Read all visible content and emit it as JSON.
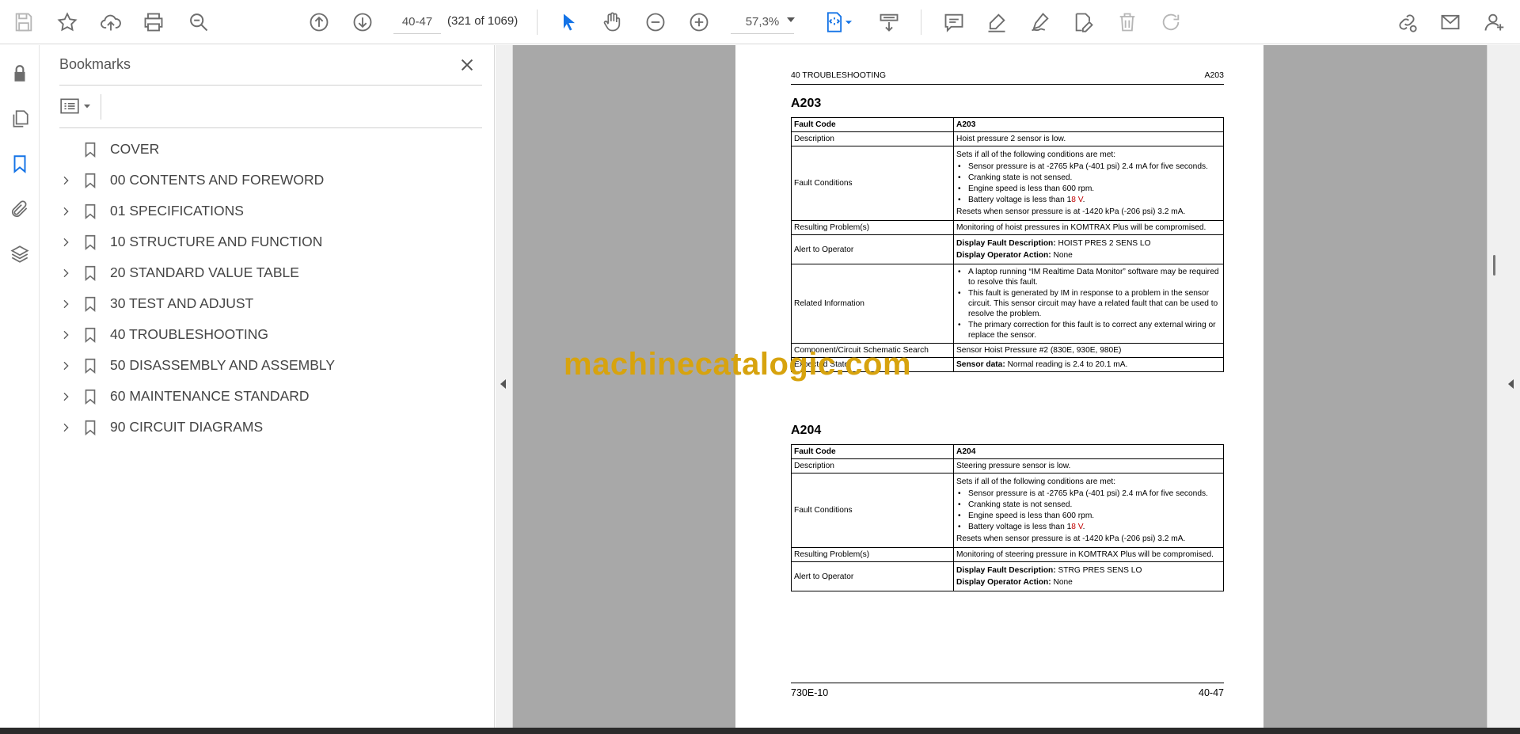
{
  "toolbar": {
    "page_value": "40-47",
    "page_count": "(321 of 1069)",
    "zoom_value": "57,3%"
  },
  "bookmarks": {
    "title": "Bookmarks",
    "items": [
      {
        "label": "COVER",
        "expandable": false
      },
      {
        "label": "00 CONTENTS AND FOREWORD",
        "expandable": true
      },
      {
        "label": "01 SPECIFICATIONS",
        "expandable": true
      },
      {
        "label": "10 STRUCTURE AND FUNCTION",
        "expandable": true
      },
      {
        "label": "20 STANDARD VALUE TABLE",
        "expandable": true
      },
      {
        "label": "30 TEST AND ADJUST",
        "expandable": true
      },
      {
        "label": "40 TROUBLESHOOTING",
        "expandable": true
      },
      {
        "label": "50 DISASSEMBLY AND ASSEMBLY",
        "expandable": true
      },
      {
        "label": "60 MAINTENANCE STANDARD",
        "expandable": true
      },
      {
        "label": "90 CIRCUIT DIAGRAMS",
        "expandable": true
      }
    ]
  },
  "document": {
    "header_left": "40 TROUBLESHOOTING",
    "header_right": "A203",
    "footer_left": "730E-10",
    "footer_right": "40-47",
    "sections": [
      {
        "title": "A203",
        "fault_code_label": "Fault Code",
        "fault_code": "A203",
        "description_label": "Description",
        "description": "Hoist pressure 2 sensor is low.",
        "fault_conditions_label": "Fault Conditions",
        "conditions_intro": "Sets if all of the following conditions are met:",
        "cond1": "Sensor pressure is at -2765 kPa (-401 psi) 2.4 mA for five seconds.",
        "cond2": "Cranking state is not sensed.",
        "cond3": "Engine speed is less than 600 rpm.",
        "cond4_pre": "Battery voltage is less than 1",
        "cond4_red": "8 V",
        "cond4_post": ".",
        "resets": "Resets when sensor pressure is at -1420 kPa (-206 psi) 3.2 mA.",
        "resulting_label": "Resulting Problem(s)",
        "resulting": "Monitoring of hoist pressures in KOMTRAX Plus will be compromised.",
        "alert_label": "Alert to Operator",
        "display_desc_label": "Display Fault Description:",
        "display_desc": "HOIST PRES 2 SENS LO",
        "display_action_label": "Display Operator Action:",
        "display_action": "None",
        "related_label": "Related Information",
        "related1": "A laptop running “IM Realtime Data Monitor” software may be required to resolve this fault.",
        "related2": "This fault is generated by IM in response to a problem in the sensor circuit. This sensor circuit may have a related fault that can be used to resolve the problem.",
        "related3": "The primary correction for this fault is to correct any external wiring or replace the sensor.",
        "component_label": "Component/Circuit Schematic Search",
        "component": "Sensor Hoist Pressure #2 (830E, 930E, 980E)",
        "expected_label": "Expected State",
        "expected_bold": "Sensor data:",
        "expected": "Normal reading is 2.4 to 20.1 mA."
      },
      {
        "title": "A204",
        "fault_code_label": "Fault Code",
        "fault_code": "A204",
        "description_label": "Description",
        "description": "Steering pressure sensor is low.",
        "fault_conditions_label": "Fault Conditions",
        "conditions_intro": "Sets if all of the following conditions are met:",
        "cond1": "Sensor pressure is at -2765 kPa (-401 psi) 2.4 mA for five seconds.",
        "cond2": "Cranking state is not sensed.",
        "cond3": "Engine speed is less than 600 rpm.",
        "cond4_pre": "Battery voltage is less than 1",
        "cond4_red": "8 V",
        "cond4_post": ".",
        "resets": "Resets when sensor pressure is at -1420 kPa (-206 psi) 3.2 mA.",
        "resulting_label": "Resulting Problem(s)",
        "resulting": "Monitoring of steering pressure in KOMTRAX Plus will be compromised.",
        "alert_label": "Alert to Operator",
        "display_desc_label": "Display Fault Description:",
        "display_desc": "STRG PRES SENS LO",
        "display_action_label": "Display Operator Action:",
        "display_action": "None"
      }
    ]
  },
  "watermark": "machinecatalogic.com",
  "colors": {
    "accent": "#1473e6",
    "doc_background": "#a8a8a8",
    "watermark": "#d7a30e",
    "red_text": "#c00000"
  },
  "icons": {
    "toolbar": [
      "save-icon",
      "star-icon",
      "upload-icon",
      "print-icon",
      "search-icon",
      "page-up-icon",
      "page-down-icon",
      "zoom-out-icon",
      "zoom-in-icon",
      "select-cursor-icon",
      "hand-icon",
      "fit-page-icon",
      "scroll-mode-icon",
      "comment-icon",
      "highlight-icon",
      "sign-icon",
      "edit-pdf-icon",
      "delete-icon",
      "rotate-icon",
      "share-link-icon",
      "email-icon",
      "account-icon"
    ],
    "rail": [
      "lock-icon",
      "pages-icon",
      "bookmark-icon",
      "attachment-icon",
      "layers-icon"
    ]
  }
}
